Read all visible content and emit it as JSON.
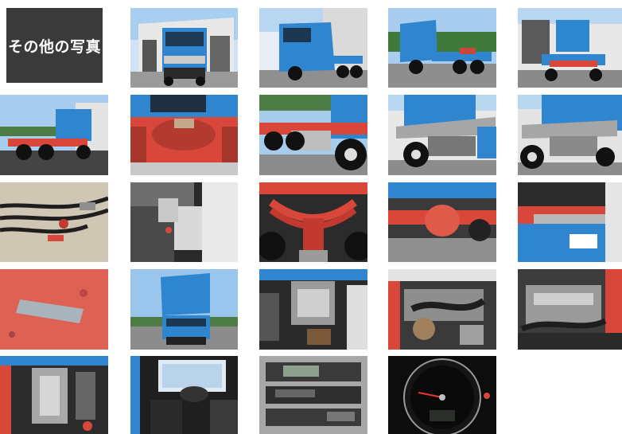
{
  "gallery": {
    "header_label": "その他の写真",
    "colors": {
      "header_bg": "#3a3a3a",
      "cab_blue": "#2f86cf",
      "frame_red": "#d8473a",
      "sky": "#8fc0ea"
    }
  }
}
